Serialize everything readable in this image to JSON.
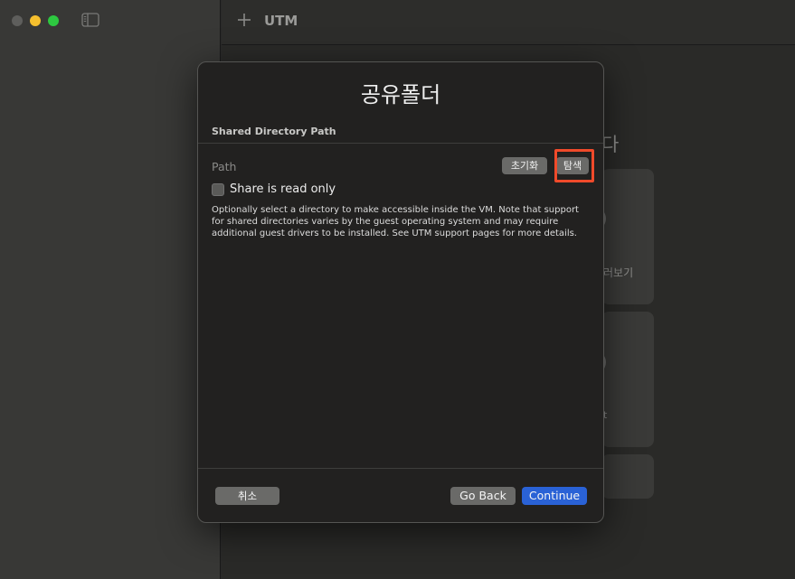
{
  "window": {
    "title": "UTM"
  },
  "background": {
    "heading_fragment": "다",
    "card1_text_fragment": "러보기",
    "card2_text_fragment": "t"
  },
  "dialog": {
    "title": "공유폴더",
    "section_label": "Shared Directory Path",
    "path_label": "Path",
    "reset_label": "초기화",
    "browse_label": "탐색",
    "readonly_label": "Share is read only",
    "readonly_checked": false,
    "description": "Optionally select a directory to make accessible inside the VM. Note that support for shared directories varies by the guest operating system and may require additional guest drivers to be installed. See UTM support pages for more details.",
    "cancel_label": "취소",
    "back_label": "Go Back",
    "continue_label": "Continue"
  },
  "colors": {
    "accent": "#2a62d6",
    "highlight": "#f04a2a",
    "traffic_yellow": "#f5bf2e",
    "traffic_green": "#2dc840"
  }
}
